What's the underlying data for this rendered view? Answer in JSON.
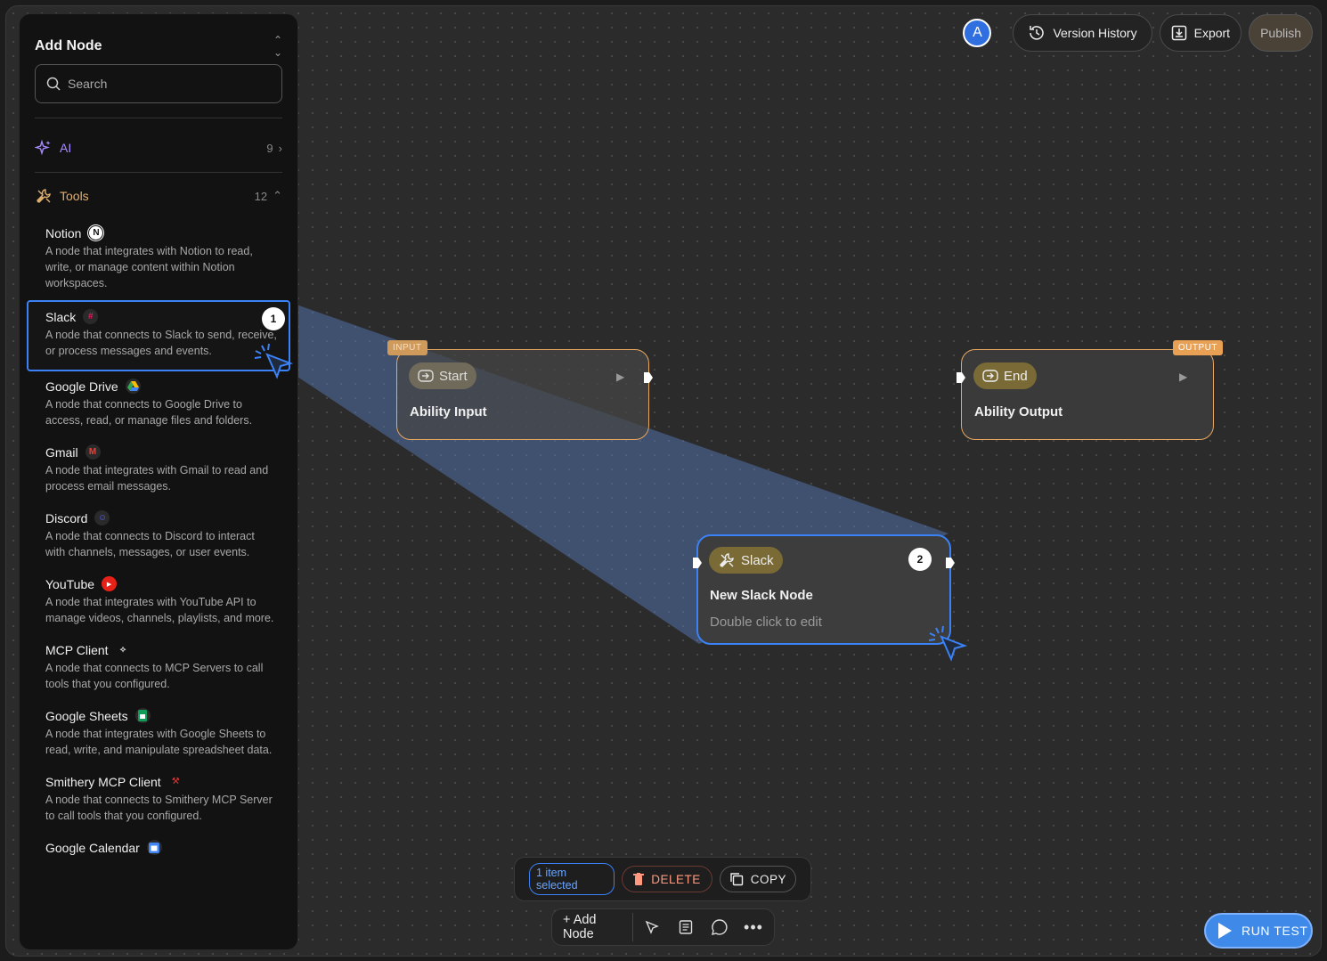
{
  "sidebar": {
    "title": "Add Node",
    "search_placeholder": "Search",
    "categories": [
      {
        "label": "AI",
        "count": "9"
      },
      {
        "label": "Tools",
        "count": "12"
      }
    ],
    "items": [
      {
        "name": "Notion",
        "icon": "notion-icon",
        "desc": "A node that integrates with Notion to read, write, or manage content within Notion workspaces."
      },
      {
        "name": "Slack",
        "icon": "slack-icon",
        "desc": "A node that connects to Slack to send, receive, or process messages and events."
      },
      {
        "name": "Google Drive",
        "icon": "google-drive-icon",
        "desc": "A node that connects to Google Drive to access, read, or manage files and folders."
      },
      {
        "name": "Gmail",
        "icon": "gmail-icon",
        "desc": "A node that integrates with Gmail to read and process email messages."
      },
      {
        "name": "Discord",
        "icon": "discord-icon",
        "desc": "A node that connects to Discord to interact with channels, messages, or user events."
      },
      {
        "name": "YouTube",
        "icon": "youtube-icon",
        "desc": "A node that integrates with YouTube API to manage videos, channels, playlists, and more."
      },
      {
        "name": "MCP Client",
        "icon": "mcp-icon",
        "desc": "A node that connects to MCP Servers to call tools that you configured."
      },
      {
        "name": "Google Sheets",
        "icon": "google-sheets-icon",
        "desc": "A node that integrates with Google Sheets to read, write, and manipulate spreadsheet data."
      },
      {
        "name": "Smithery MCP Client",
        "icon": "smithery-icon",
        "desc": "A node that connects to Smithery MCP Server to call tools that you configured."
      },
      {
        "name": "Google Calendar",
        "icon": "google-calendar-icon",
        "desc": ""
      }
    ],
    "selected_badge": "1"
  },
  "topbar": {
    "avatar": "A",
    "version_history": "Version History",
    "export": "Export",
    "publish": "Publish"
  },
  "canvas": {
    "start_node": {
      "tag": "INPUT",
      "chip": "Start",
      "title": "Ability Input"
    },
    "end_node": {
      "tag": "OUTPUT",
      "chip": "End",
      "title": "Ability Output"
    },
    "slack_node": {
      "chip": "Slack",
      "title": "New Slack Node",
      "hint": "Double click to edit",
      "badge": "2"
    }
  },
  "selection_bar": {
    "count": "1 item selected",
    "delete": "DELETE",
    "copy": "COPY"
  },
  "toolbar": {
    "add_node": "+ Add Node"
  },
  "run_test": "RUN TEST",
  "colors": {
    "accent_blue": "#3b82f6",
    "node_orange": "#e8a860",
    "ai_purple": "#a98bff",
    "tools_orange": "#e0b070"
  }
}
